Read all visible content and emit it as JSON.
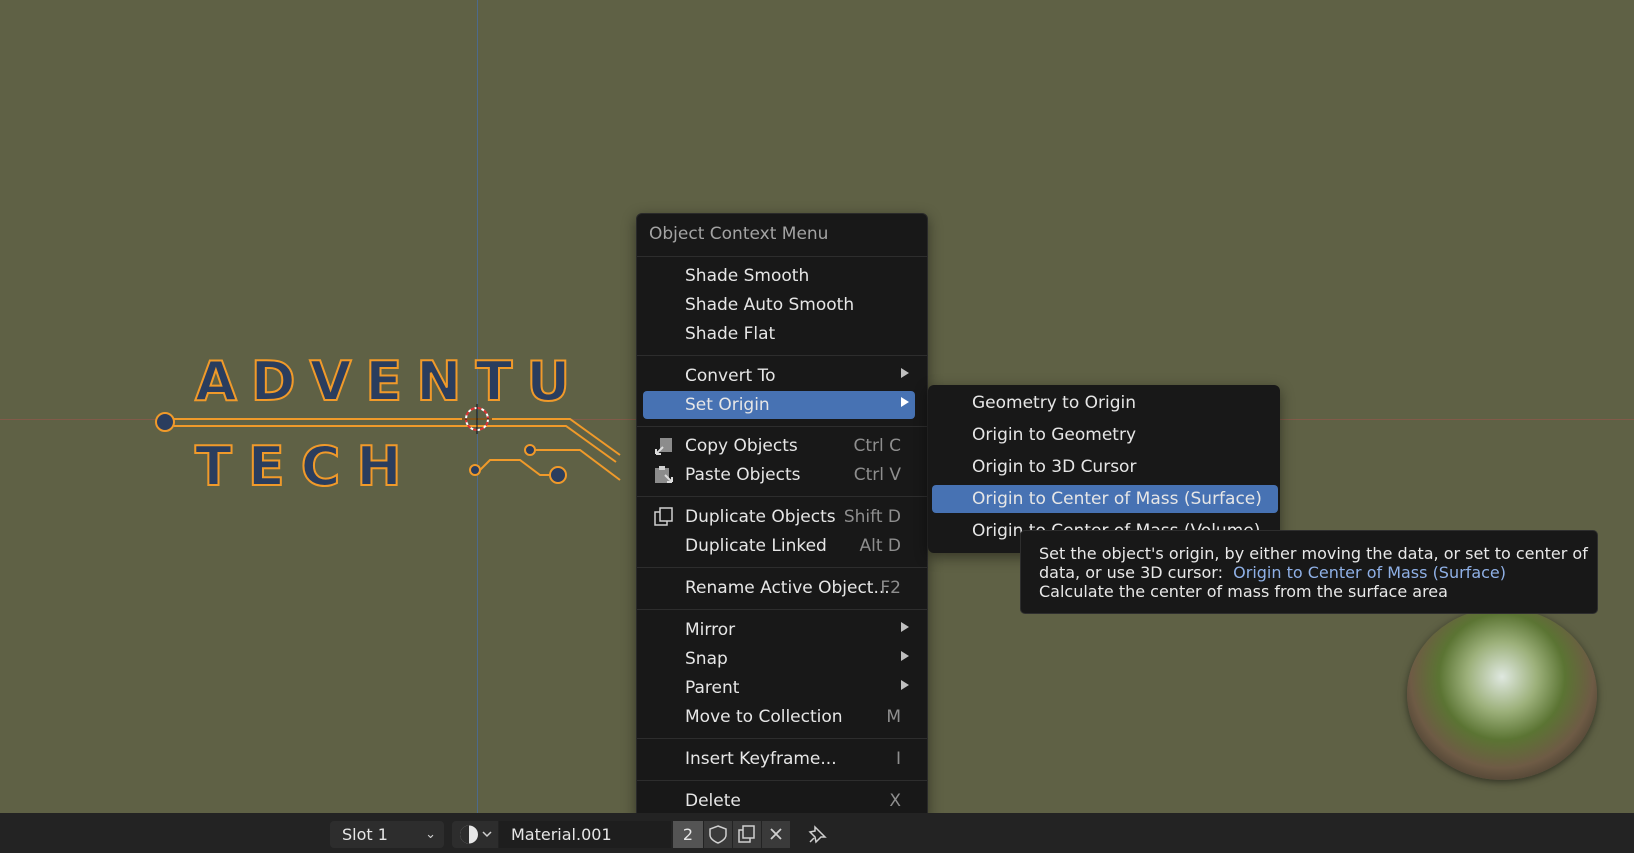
{
  "context_menu": {
    "title": "Object Context Menu",
    "items": [
      {
        "label": "Shade Smooth"
      },
      {
        "label": "Shade Auto Smooth"
      },
      {
        "label": "Shade Flat"
      },
      {
        "label": "Convert To"
      },
      {
        "label": "Set Origin"
      },
      {
        "label": "Copy Objects",
        "shortcut": "Ctrl C"
      },
      {
        "label": "Paste Objects",
        "shortcut": "Ctrl V"
      },
      {
        "label": "Duplicate Objects",
        "shortcut": "Shift D"
      },
      {
        "label": "Duplicate Linked",
        "shortcut": "Alt D"
      },
      {
        "label": "Rename Active Object...",
        "shortcut": "F2"
      },
      {
        "label": "Mirror"
      },
      {
        "label": "Snap"
      },
      {
        "label": "Parent"
      },
      {
        "label": "Move to Collection",
        "shortcut": "M"
      },
      {
        "label": "Insert Keyframe...",
        "shortcut": "I"
      },
      {
        "label": "Delete",
        "shortcut": "X"
      }
    ]
  },
  "set_origin_submenu": {
    "items": [
      {
        "label": "Geometry to Origin"
      },
      {
        "label": "Origin to Geometry"
      },
      {
        "label": "Origin to 3D Cursor"
      },
      {
        "label": "Origin to Center of Mass (Surface)"
      },
      {
        "label": "Origin to Center of Mass (Volume)"
      }
    ]
  },
  "tooltip": {
    "line1": "Set the object's origin, by either moving the data, or set to center of",
    "line2_prefix": "data, or use 3D cursor:",
    "line2_highlight": "Origin to Center of Mass (Surface)",
    "line3": "Calculate the center of mass from the surface area"
  },
  "viewport": {
    "logo_line1": "ADVENTU",
    "logo_line2": "TECH"
  },
  "bottom_bar": {
    "slot_label": "Slot 1",
    "material_name": "Material.001",
    "user_count": "2"
  },
  "colors": {
    "accent": "#4772b3",
    "viewport_bg": "#5f6145",
    "logo_fill": "#2a3d5e",
    "logo_stroke": "#f09a2a"
  },
  "icons": [
    "copy-icon",
    "paste-icon",
    "duplicate-icon",
    "shield-icon",
    "new-material-icon",
    "close-icon",
    "pin-icon",
    "chevron-down-icon",
    "submenu-arrow-icon"
  ]
}
